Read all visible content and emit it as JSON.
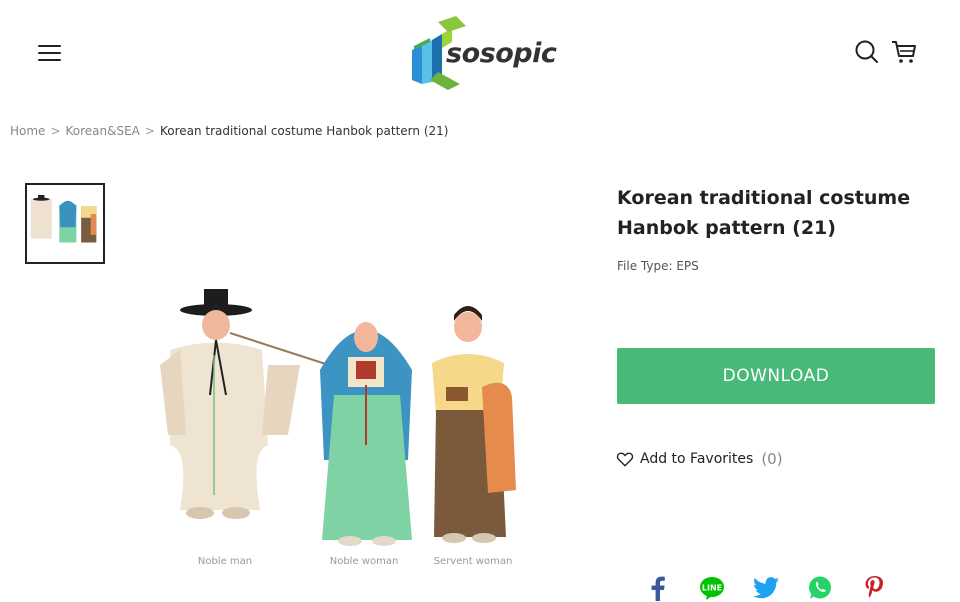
{
  "header": {
    "menu_icon": "hamburger-icon",
    "logo_text": "sosopic",
    "search_icon": "search-icon",
    "cart_icon": "cart-icon"
  },
  "breadcrumb": {
    "items": [
      "Home",
      "Korean&SEA"
    ],
    "separator": ">",
    "current": "Korean traditional costume Hanbok pattern (21)"
  },
  "product": {
    "title": "Korean traditional costume Hanbok pattern (21)",
    "file_type": "File Type: EPS",
    "download_label": "DOWNLOAD",
    "favorites_label": "Add to Favorites",
    "favorites_count": "(0)",
    "image_captions": [
      "Noble man",
      "Noble woman",
      "Servent woman"
    ]
  },
  "share": [
    "facebook-icon",
    "line-icon",
    "twitter-icon",
    "whatsapp-icon",
    "pinterest-icon"
  ],
  "colors": {
    "accent": "#48b978",
    "facebook": "#3b5998",
    "line": "#00c300",
    "twitter": "#1da1f2",
    "whatsapp": "#25d366",
    "pinterest": "#cb2027"
  }
}
